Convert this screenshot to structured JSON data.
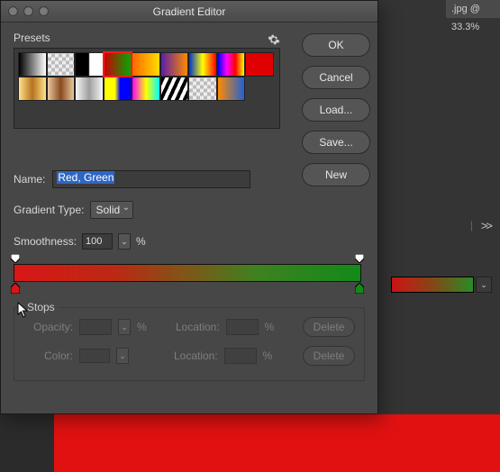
{
  "dialog": {
    "title": "Gradient Editor",
    "presets_label": "Presets",
    "name_label": "Name:",
    "name_value": "Red, Green",
    "gradient_type_label": "Gradient Type:",
    "gradient_type_value": "Solid",
    "smoothness_label": "Smoothness:",
    "smoothness_value": "100",
    "smoothness_unit": "%",
    "stops_label": "Stops",
    "opacity_label": "Opacity:",
    "color_label": "Color:",
    "location_label": "Location:",
    "percent": "%",
    "delete_label": "Delete"
  },
  "buttons": {
    "ok": "OK",
    "cancel": "Cancel",
    "load": "Load...",
    "save": "Save...",
    "new": "New"
  },
  "right": {
    "tab": ".jpg @ 33.3%",
    "chevrons": ">>"
  },
  "presets": {
    "row1": [
      "linear-gradient(to right,#000,#fff)",
      "repeating-conic-gradient(#bbb 0 25%,#eee 0 50%) 0/8px 8px",
      "linear-gradient(to right,#000 0%,#000 48%,#fff 52%,#fff 100%)",
      "linear-gradient(to right,#c00,#0a0)",
      "linear-gradient(to right,#f60,#fd0)",
      "linear-gradient(to right,#5b1ea6,#ff8a00)",
      "linear-gradient(to right,#0033cc,#ff0,#f00)",
      "linear-gradient(to right,#00f,#f0f,#f00,#ff0)",
      "linear-gradient(to right,#e00000,#e00000)"
    ],
    "row2": [
      "linear-gradient(to right,#ffe28a,#b87320,#ffe28a)",
      "linear-gradient(to right,#e9c8a0,#8a4a20,#e9c8a0)",
      "linear-gradient(to right,#f7f7f7,#9e9e9e,#f7f7f7)",
      "linear-gradient(to right,#ff0,#ff0 40%,#00f 60%,#00f)",
      "linear-gradient(to right,#f0f,#ff0,#0ff)",
      "repeating-linear-gradient(115deg,#000 0 4px,#fff 4px 8px)",
      "repeating-conic-gradient(#bbb 0 25%,#eee 0 50%) 0/8px 8px",
      "linear-gradient(to right,#ff8a00,#2061d4)"
    ],
    "selected_index": 3
  }
}
